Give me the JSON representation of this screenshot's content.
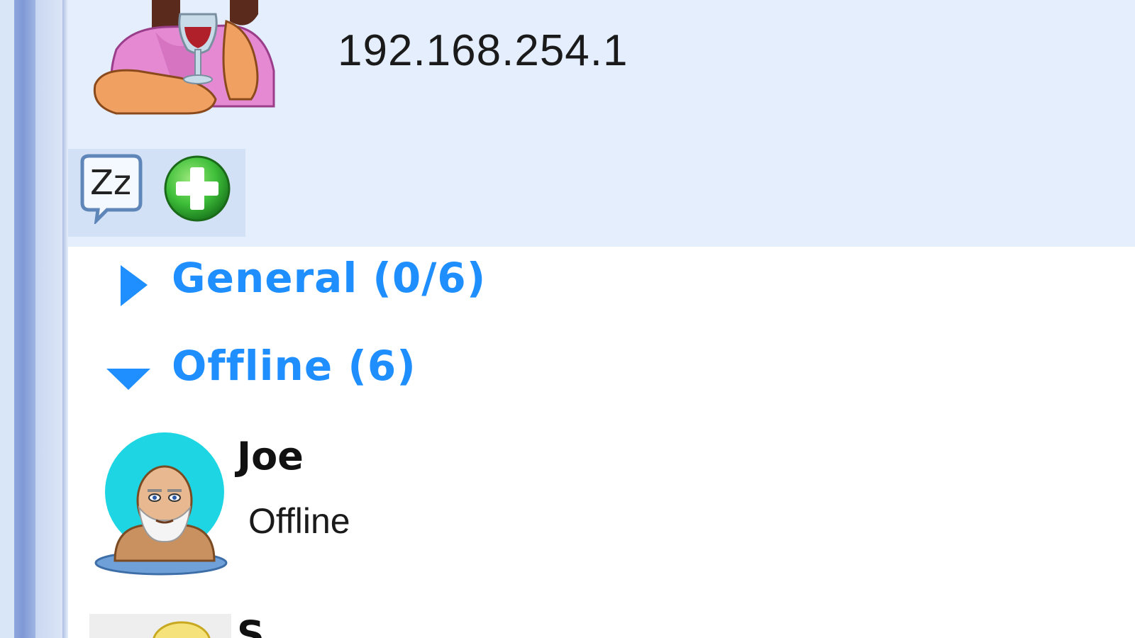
{
  "profile": {
    "ip_address": "192.168.254.1",
    "avatar_icon": "woman-with-wine-avatar-icon"
  },
  "toolbar": {
    "away_icon": "sleep-zz-icon",
    "away_label": "Zz",
    "add_icon": "green-plus-icon"
  },
  "groups": [
    {
      "label": "General (0/6)",
      "expanded": false
    },
    {
      "label": "Offline (6)",
      "expanded": true
    }
  ],
  "contacts": [
    {
      "name": "Joe",
      "status": "Offline",
      "avatar_icon": "old-man-avatar-icon"
    },
    {
      "name": "S",
      "avatar_icon": "yellow-avatar-icon"
    }
  ],
  "colors": {
    "group_text": "#1f8fff",
    "header_bg": "#e4eefd",
    "toolbar_bg": "#d3e1f6",
    "avatar_ring": "#1ed6e3"
  }
}
